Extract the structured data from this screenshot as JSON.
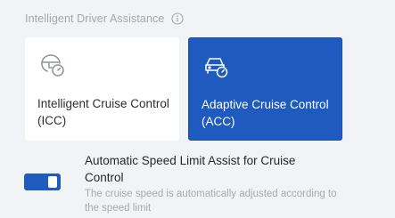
{
  "section": {
    "title": "Intelligent Driver Assistance",
    "info_icon": "info-icon"
  },
  "cruise_modes": [
    {
      "label": "Intelligent Cruise Control (ICC)",
      "icon": "steering-wheel-speedometer-icon",
      "selected": false
    },
    {
      "label": "Adaptive Cruise Control (ACC)",
      "icon": "car-speedometer-icon",
      "selected": true
    }
  ],
  "speed_limit_assist": {
    "title": "Automatic Speed Limit Assist for Cruise Control",
    "description": "The cruise speed is automatically adjusted according to the speed limit",
    "enabled": true
  },
  "colors": {
    "accent": "#1f5bbf",
    "panel_background": "#f2f3f6",
    "muted_text": "#a3a7ae"
  }
}
